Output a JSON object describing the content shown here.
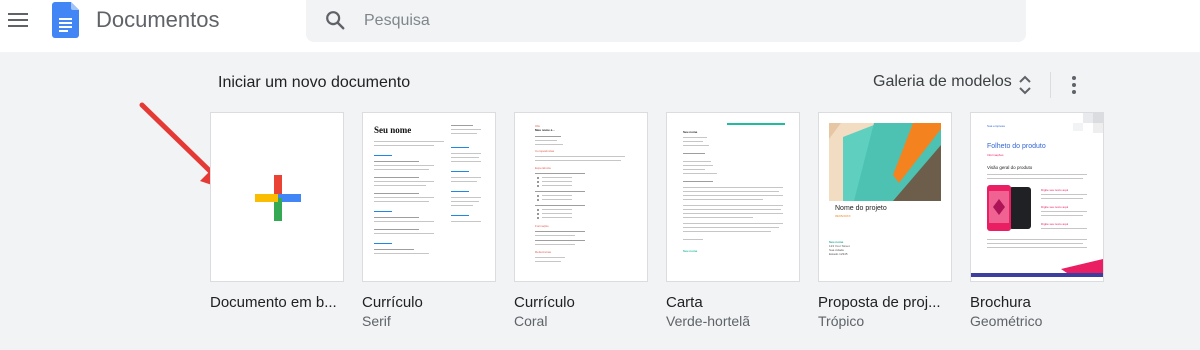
{
  "header": {
    "app_title": "Documentos",
    "search_placeholder": "Pesquisa"
  },
  "toolbar": {
    "section_title": "Iniciar um novo documento",
    "gallery_label": "Galeria de modelos"
  },
  "templates": [
    {
      "name": "Documento em branco",
      "display_name": "Documento em b...",
      "subtitle": ""
    },
    {
      "name": "Currículo",
      "subtitle": "Serif"
    },
    {
      "name": "Currículo",
      "subtitle": "Coral"
    },
    {
      "name": "Carta",
      "subtitle": "Verde-hortelã"
    },
    {
      "name": "Proposta de projeto",
      "display_name": "Proposta de proj...",
      "subtitle": "Trópico"
    },
    {
      "name": "Brochura",
      "subtitle": "Geométrico"
    }
  ],
  "previews": {
    "serif": {
      "heading": "Seu nome"
    },
    "coral": {
      "hello": "Olá",
      "heading": "Meu nome é...",
      "sections": [
        "Competências",
        "Experiência",
        "Formação",
        "Referências"
      ]
    },
    "letter": {
      "sender": "Seu nome",
      "closing": "Seu nome"
    },
    "proposal": {
      "title": "Nome do projeto",
      "date": "09/05/20XX",
      "sender": "Seu nome",
      "address": [
        "123 Your Street",
        "Sua cidade",
        "Estado 12345"
      ]
    },
    "brochure": {
      "company": "Sua empresa",
      "title": "Folheto do produto",
      "subtitle": "Informações",
      "overview": "Visão geral do produto",
      "point1": "Digite seu texto aqui",
      "point2": "Digite seu texto aqui",
      "point3": "Digite seu texto aqui"
    }
  },
  "colors": {
    "docs_blue": "#4285f4",
    "coral": "#e06055",
    "mint": "#1fbca0",
    "serif_accent": "#1e88e5",
    "brochure_blue": "#3367d6",
    "brochure_pink": "#e91e63",
    "arrow_red": "#e53935"
  }
}
